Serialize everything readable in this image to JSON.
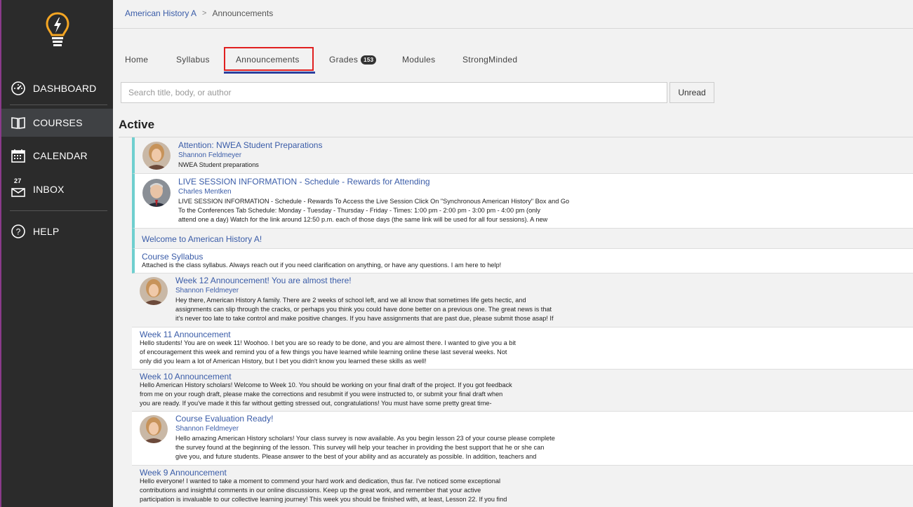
{
  "sidebar": {
    "items": [
      {
        "label": "DASHBOARD",
        "icon": "dashboard-gauge-icon"
      },
      {
        "label": "COURSES",
        "icon": "book-icon"
      },
      {
        "label": "CALENDAR",
        "icon": "calendar-icon"
      },
      {
        "label": "INBOX",
        "icon": "mail-icon",
        "badge": "27"
      },
      {
        "label": "HELP",
        "icon": "question-circle-icon"
      }
    ],
    "active": "COURSES",
    "logo_icon": "lightbulb-bolt-icon",
    "accent_color": "#f5a623"
  },
  "breadcrumb": {
    "course": "American History A",
    "separator": ">",
    "current": "Announcements"
  },
  "tabs": [
    {
      "label": "Home"
    },
    {
      "label": "Syllabus"
    },
    {
      "label": "Announcements",
      "active": true
    },
    {
      "label": "Grades",
      "count": "153"
    },
    {
      "label": "Modules"
    },
    {
      "label": "StrongMinded"
    }
  ],
  "search": {
    "placeholder": "Search title, body, or author"
  },
  "unread_button": "Unread",
  "section_title": "Active",
  "announcements": [
    {
      "title": "Attention: NWEA Student Preparations",
      "author": "Shannon Feldmeyer",
      "body": "NWEA Student preparations"
    },
    {
      "title": "LIVE SESSION INFORMATION - Schedule - Rewards for Attending",
      "author": "Charles Mentken",
      "body_lines": [
        "LIVE SESSION INFORMATION - Schedule - Rewards To Access the Live Session Click On \"Synchronous American History\" Box and Go",
        "To the Conferences Tab   Schedule: Monday - Tuesday - Thursday - Friday - Times:  1:00 pm - 2:00 pm - 3:00 pm - 4:00 pm (only",
        "attend one a day) Watch for the link around 12:50 p.m. each of those days (the same link will be used for all four sessions). A new"
      ]
    },
    {
      "title": "Welcome to American History A!"
    },
    {
      "title": "Course Syllabus",
      "body": "Attached is the class syllabus. Always reach out if you need clarification on anything, or have any questions. I am here to help!"
    },
    {
      "title": "Week 12 Announcement! You are almost there!",
      "author": "Shannon Feldmeyer",
      "body_lines": [
        "Hey there, American History A family.  There are 2 weeks of school left, and we all know that sometimes life gets hectic, and",
        "assignments can slip through the cracks, or perhaps you think you could have done better on a previous one. The great news is that",
        "it's never too late to take control and make positive changes. If you have assignments that are past due, please submit those asap! If"
      ]
    },
    {
      "title": "Week 11 Announcement",
      "body_lines": [
        "Hello students! You are on week 11! Woohoo. I bet you are so ready to be done, and you are almost there. I wanted to give you a bit",
        "of encouragement this week and remind you of a few things you have learned while learning online these last several weeks. Not",
        "only did you learn a lot of American History, but I bet you didn't know you learned these skills as well!"
      ]
    },
    {
      "title": "Week 10 Announcement",
      "body_lines": [
        "Hello American History scholars!  Welcome to Week 10. You should be working on your final draft of the project. If you got feedback",
        "from me on your rough draft, please make the corrections and resubmit if you were instructed to, or submit your final draft when",
        "you are ready. If you've made it this far without getting stressed out, congratulations! You must have some pretty great time-"
      ]
    },
    {
      "title": "Course Evaluation Ready!",
      "author": "Shannon Feldmeyer",
      "body_lines": [
        "Hello amazing American History scholars! Your class survey is now available. As you begin lesson 23 of your course please complete",
        "the survey found at the beginning of the lesson. This survey will help your teacher in providing the best support that he or she can",
        "give you, and future students. Please answer to the best of your ability and as accurately as possible. In addition, teachers and"
      ]
    },
    {
      "title": "Week 9 Announcement",
      "body_lines": [
        "Hello everyone! I wanted to take a moment to commend your hard work and dedication, thus far. I've noticed some exceptional",
        "contributions and insightful comments in our online discussions. Keep up the great work, and remember that your active",
        "participation is invaluable to our collective learning journey! This week you should be finished with, at least, Lesson 22. If you find"
      ]
    }
  ],
  "colors": {
    "link": "#3a5ca8",
    "pinned_bar": "#6fcfcf",
    "tab_underline": "#2b3f9e",
    "tab_highlight": "#e02020"
  }
}
